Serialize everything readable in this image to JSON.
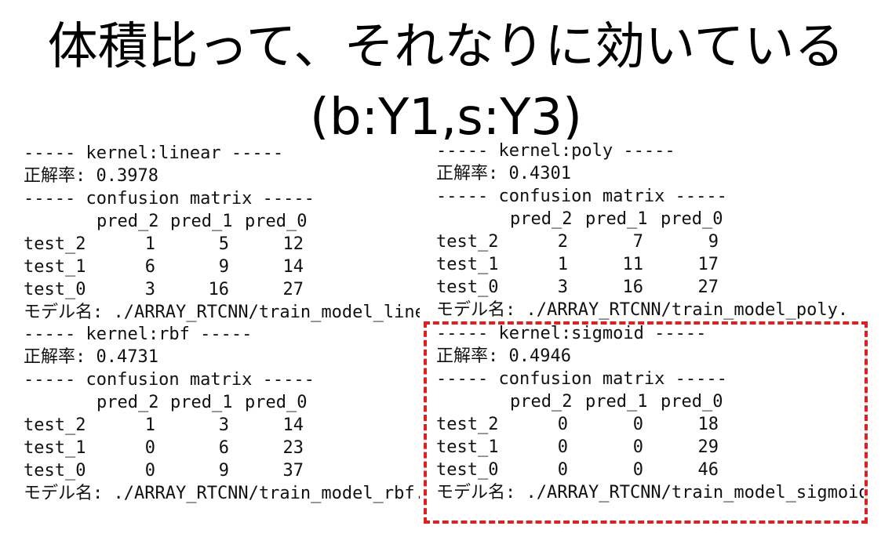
{
  "title": {
    "line1": "体積比って、それなりに効いている",
    "line2": "(b:Y1,s:Y3)"
  },
  "highlight_color": "#e02020",
  "panels": {
    "linear": {
      "kernel_header": "----- kernel:linear -----",
      "accuracy": "正解率: 0.3978",
      "cm_header": "----- confusion matrix -----",
      "cols": [
        "pred_2",
        "pred_1",
        "pred_0"
      ],
      "rows": [
        {
          "label": "test_2",
          "values": [
            "1",
            "5",
            "12"
          ]
        },
        {
          "label": "test_1",
          "values": [
            "6",
            "9",
            "14"
          ]
        },
        {
          "label": "test_0",
          "values": [
            "3",
            "16",
            "27"
          ]
        }
      ],
      "model": "モデル名: ./ARRAY_RTCNN/train_model_linear.m"
    },
    "poly": {
      "kernel_header": "----- kernel:poly -----",
      "accuracy": "正解率: 0.4301",
      "cm_header": "----- confusion matrix -----",
      "cols": [
        "pred_2",
        "pred_1",
        "pred_0"
      ],
      "rows": [
        {
          "label": "test_2",
          "values": [
            "2",
            "7",
            "9"
          ]
        },
        {
          "label": "test_1",
          "values": [
            "1",
            "11",
            "17"
          ]
        },
        {
          "label": "test_0",
          "values": [
            "3",
            "16",
            "27"
          ]
        }
      ],
      "model": "モデル名: ./ARRAY_RTCNN/train_model_poly.m"
    },
    "rbf": {
      "kernel_header": "----- kernel:rbf -----",
      "accuracy": "正解率: 0.4731",
      "cm_header": "----- confusion matrix -----",
      "cols": [
        "pred_2",
        "pred_1",
        "pred_0"
      ],
      "rows": [
        {
          "label": "test_2",
          "values": [
            "1",
            "3",
            "14"
          ]
        },
        {
          "label": "test_1",
          "values": [
            "0",
            "6",
            "23"
          ]
        },
        {
          "label": "test_0",
          "values": [
            "0",
            "9",
            "37"
          ]
        }
      ],
      "model": "モデル名: ./ARRAY_RTCNN/train_model_rbf.m"
    },
    "sigmoid": {
      "kernel_header": "----- kernel:sigmoid -----",
      "accuracy": "正解率: 0.4946",
      "cm_header": "----- confusion matrix -----",
      "cols": [
        "pred_2",
        "pred_1",
        "pred_0"
      ],
      "rows": [
        {
          "label": "test_2",
          "values": [
            "0",
            "0",
            "18"
          ]
        },
        {
          "label": "test_1",
          "values": [
            "0",
            "0",
            "29"
          ]
        },
        {
          "label": "test_0",
          "values": [
            "0",
            "0",
            "46"
          ]
        }
      ],
      "model": "モデル名: ./ARRAY_RTCNN/train_model_sigmoid.m"
    }
  }
}
